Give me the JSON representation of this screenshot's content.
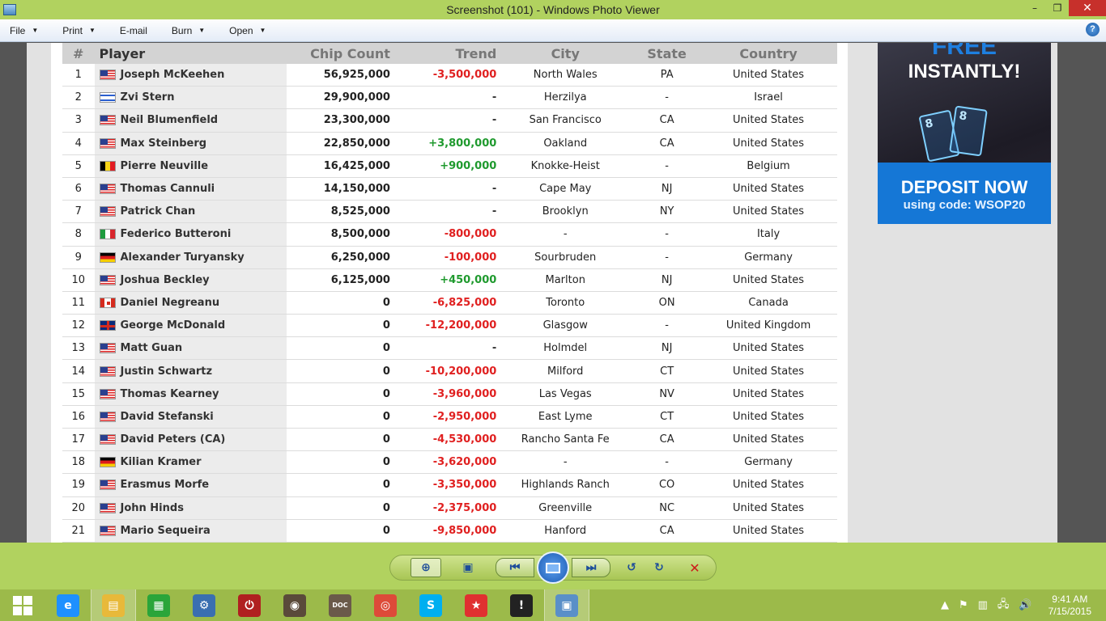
{
  "window": {
    "title": "Screenshot (101) - Windows Photo Viewer"
  },
  "menu": {
    "items": [
      {
        "label": "File"
      },
      {
        "label": "Print"
      },
      {
        "label": "E-mail"
      },
      {
        "label": "Burn"
      },
      {
        "label": "Open"
      }
    ]
  },
  "icons": {
    "help": "?",
    "minimize": "–",
    "maximize": "❐",
    "close": "✕",
    "dropdown": "▼",
    "zoom": "⊕",
    "fit": "▣",
    "previous": "⏮",
    "next": "⏭",
    "rotate_ccw": "↺",
    "rotate_cw": "↻",
    "delete": "✕"
  },
  "ad": {
    "top_text": "FREE",
    "instantly": "INSTANTLY!",
    "card1": "8",
    "card2": "8",
    "deposit": "DEPOSIT NOW",
    "code": "using code: WSOP20"
  },
  "table": {
    "headers": {
      "num": "#",
      "player": "Player",
      "chips": "Chip Count",
      "trend": "Trend",
      "city": "City",
      "state": "State",
      "country": "Country"
    },
    "rows": [
      {
        "num": "1",
        "flag": "us",
        "player": "Joseph McKeehen",
        "chips": "56,925,000",
        "trend": "-3,500,000",
        "trend_type": "neg",
        "city": "North Wales",
        "state": "PA",
        "country": "United States"
      },
      {
        "num": "2",
        "flag": "il",
        "player": "Zvi Stern",
        "chips": "29,900,000",
        "trend": "-",
        "trend_type": "dash",
        "city": "Herzilya",
        "state": "-",
        "country": "Israel"
      },
      {
        "num": "3",
        "flag": "us",
        "player": "Neil Blumenfield",
        "chips": "23,300,000",
        "trend": "-",
        "trend_type": "dash",
        "city": "San Francisco",
        "state": "CA",
        "country": "United States"
      },
      {
        "num": "4",
        "flag": "us",
        "player": "Max Steinberg",
        "chips": "22,850,000",
        "trend": "+3,800,000",
        "trend_type": "pos",
        "city": "Oakland",
        "state": "CA",
        "country": "United States"
      },
      {
        "num": "5",
        "flag": "be",
        "player": "Pierre Neuville",
        "chips": "16,425,000",
        "trend": "+900,000",
        "trend_type": "pos",
        "city": "Knokke-Heist",
        "state": "-",
        "country": "Belgium"
      },
      {
        "num": "6",
        "flag": "us",
        "player": "Thomas Cannuli",
        "chips": "14,150,000",
        "trend": "-",
        "trend_type": "dash",
        "city": "Cape May",
        "state": "NJ",
        "country": "United States"
      },
      {
        "num": "7",
        "flag": "us",
        "player": "Patrick Chan",
        "chips": "8,525,000",
        "trend": "-",
        "trend_type": "dash",
        "city": "Brooklyn",
        "state": "NY",
        "country": "United States"
      },
      {
        "num": "8",
        "flag": "it",
        "player": "Federico Butteroni",
        "chips": "8,500,000",
        "trend": "-800,000",
        "trend_type": "neg",
        "city": "-",
        "state": "-",
        "country": "Italy"
      },
      {
        "num": "9",
        "flag": "de",
        "player": "Alexander Turyansky",
        "chips": "6,250,000",
        "trend": "-100,000",
        "trend_type": "neg",
        "city": "Sourbruden",
        "state": "-",
        "country": "Germany"
      },
      {
        "num": "10",
        "flag": "us",
        "player": "Joshua Beckley",
        "chips": "6,125,000",
        "trend": "+450,000",
        "trend_type": "pos",
        "city": "Marlton",
        "state": "NJ",
        "country": "United States"
      },
      {
        "num": "11",
        "flag": "ca",
        "player": "Daniel Negreanu",
        "chips": "0",
        "trend": "-6,825,000",
        "trend_type": "neg",
        "city": "Toronto",
        "state": "ON",
        "country": "Canada"
      },
      {
        "num": "12",
        "flag": "gb",
        "player": "George McDonald",
        "chips": "0",
        "trend": "-12,200,000",
        "trend_type": "neg",
        "city": "Glasgow",
        "state": "-",
        "country": "United Kingdom"
      },
      {
        "num": "13",
        "flag": "us",
        "player": "Matt Guan",
        "chips": "0",
        "trend": "-",
        "trend_type": "dash",
        "city": "Holmdel",
        "state": "NJ",
        "country": "United States"
      },
      {
        "num": "14",
        "flag": "us",
        "player": "Justin Schwartz",
        "chips": "0",
        "trend": "-10,200,000",
        "trend_type": "neg",
        "city": "Milford",
        "state": "CT",
        "country": "United States"
      },
      {
        "num": "15",
        "flag": "us",
        "player": "Thomas Kearney",
        "chips": "0",
        "trend": "-3,960,000",
        "trend_type": "neg",
        "city": "Las Vegas",
        "state": "NV",
        "country": "United States"
      },
      {
        "num": "16",
        "flag": "us",
        "player": "David Stefanski",
        "chips": "0",
        "trend": "-2,950,000",
        "trend_type": "neg",
        "city": "East Lyme",
        "state": "CT",
        "country": "United States"
      },
      {
        "num": "17",
        "flag": "us",
        "player": "David Peters (CA)",
        "chips": "0",
        "trend": "-4,530,000",
        "trend_type": "neg",
        "city": "Rancho Santa Fe",
        "state": "CA",
        "country": "United States"
      },
      {
        "num": "18",
        "flag": "de",
        "player": "Kilian Kramer",
        "chips": "0",
        "trend": "-3,620,000",
        "trend_type": "neg",
        "city": "-",
        "state": "-",
        "country": "Germany"
      },
      {
        "num": "19",
        "flag": "us",
        "player": "Erasmus Morfe",
        "chips": "0",
        "trend": "-3,350,000",
        "trend_type": "neg",
        "city": "Highlands Ranch",
        "state": "CO",
        "country": "United States"
      },
      {
        "num": "20",
        "flag": "us",
        "player": "John Hinds",
        "chips": "0",
        "trend": "-2,375,000",
        "trend_type": "neg",
        "city": "Greenville",
        "state": "NC",
        "country": "United States"
      },
      {
        "num": "21",
        "flag": "us",
        "player": "Mario Sequeira",
        "chips": "0",
        "trend": "-9,850,000",
        "trend_type": "neg",
        "city": "Hanford",
        "state": "CA",
        "country": "United States"
      }
    ]
  },
  "taskbar": {
    "apps": [
      {
        "name": "internet-explorer",
        "glyph": "e",
        "color": "#1e90ff"
      },
      {
        "name": "file-explorer",
        "glyph": "▤",
        "color": "#e8b93a"
      },
      {
        "name": "store",
        "glyph": "▦",
        "color": "#2aa53a"
      },
      {
        "name": "control-panel",
        "glyph": "⚙",
        "color": "#3a6fb0"
      },
      {
        "name": "power",
        "glyph": "⏻",
        "color": "#b02020"
      },
      {
        "name": "speaker-app",
        "glyph": "◉",
        "color": "#5a4a3a"
      },
      {
        "name": "document-app",
        "glyph": "DOC",
        "color": "#6a5a4a"
      },
      {
        "name": "chrome",
        "glyph": "◎",
        "color": "#dd4b39"
      },
      {
        "name": "skype",
        "glyph": "S",
        "color": "#00aff0"
      },
      {
        "name": "star-app",
        "glyph": "★",
        "color": "#e03030"
      },
      {
        "name": "alert-app",
        "glyph": "!",
        "color": "#222222"
      },
      {
        "name": "photo-viewer",
        "glyph": "▣",
        "color": "#5a8fc8"
      }
    ],
    "tray": {
      "icons": [
        "▲",
        "⚑",
        "▥",
        "🖧",
        "🔊"
      ],
      "time": "9:41 AM",
      "date": "7/15/2015"
    }
  }
}
